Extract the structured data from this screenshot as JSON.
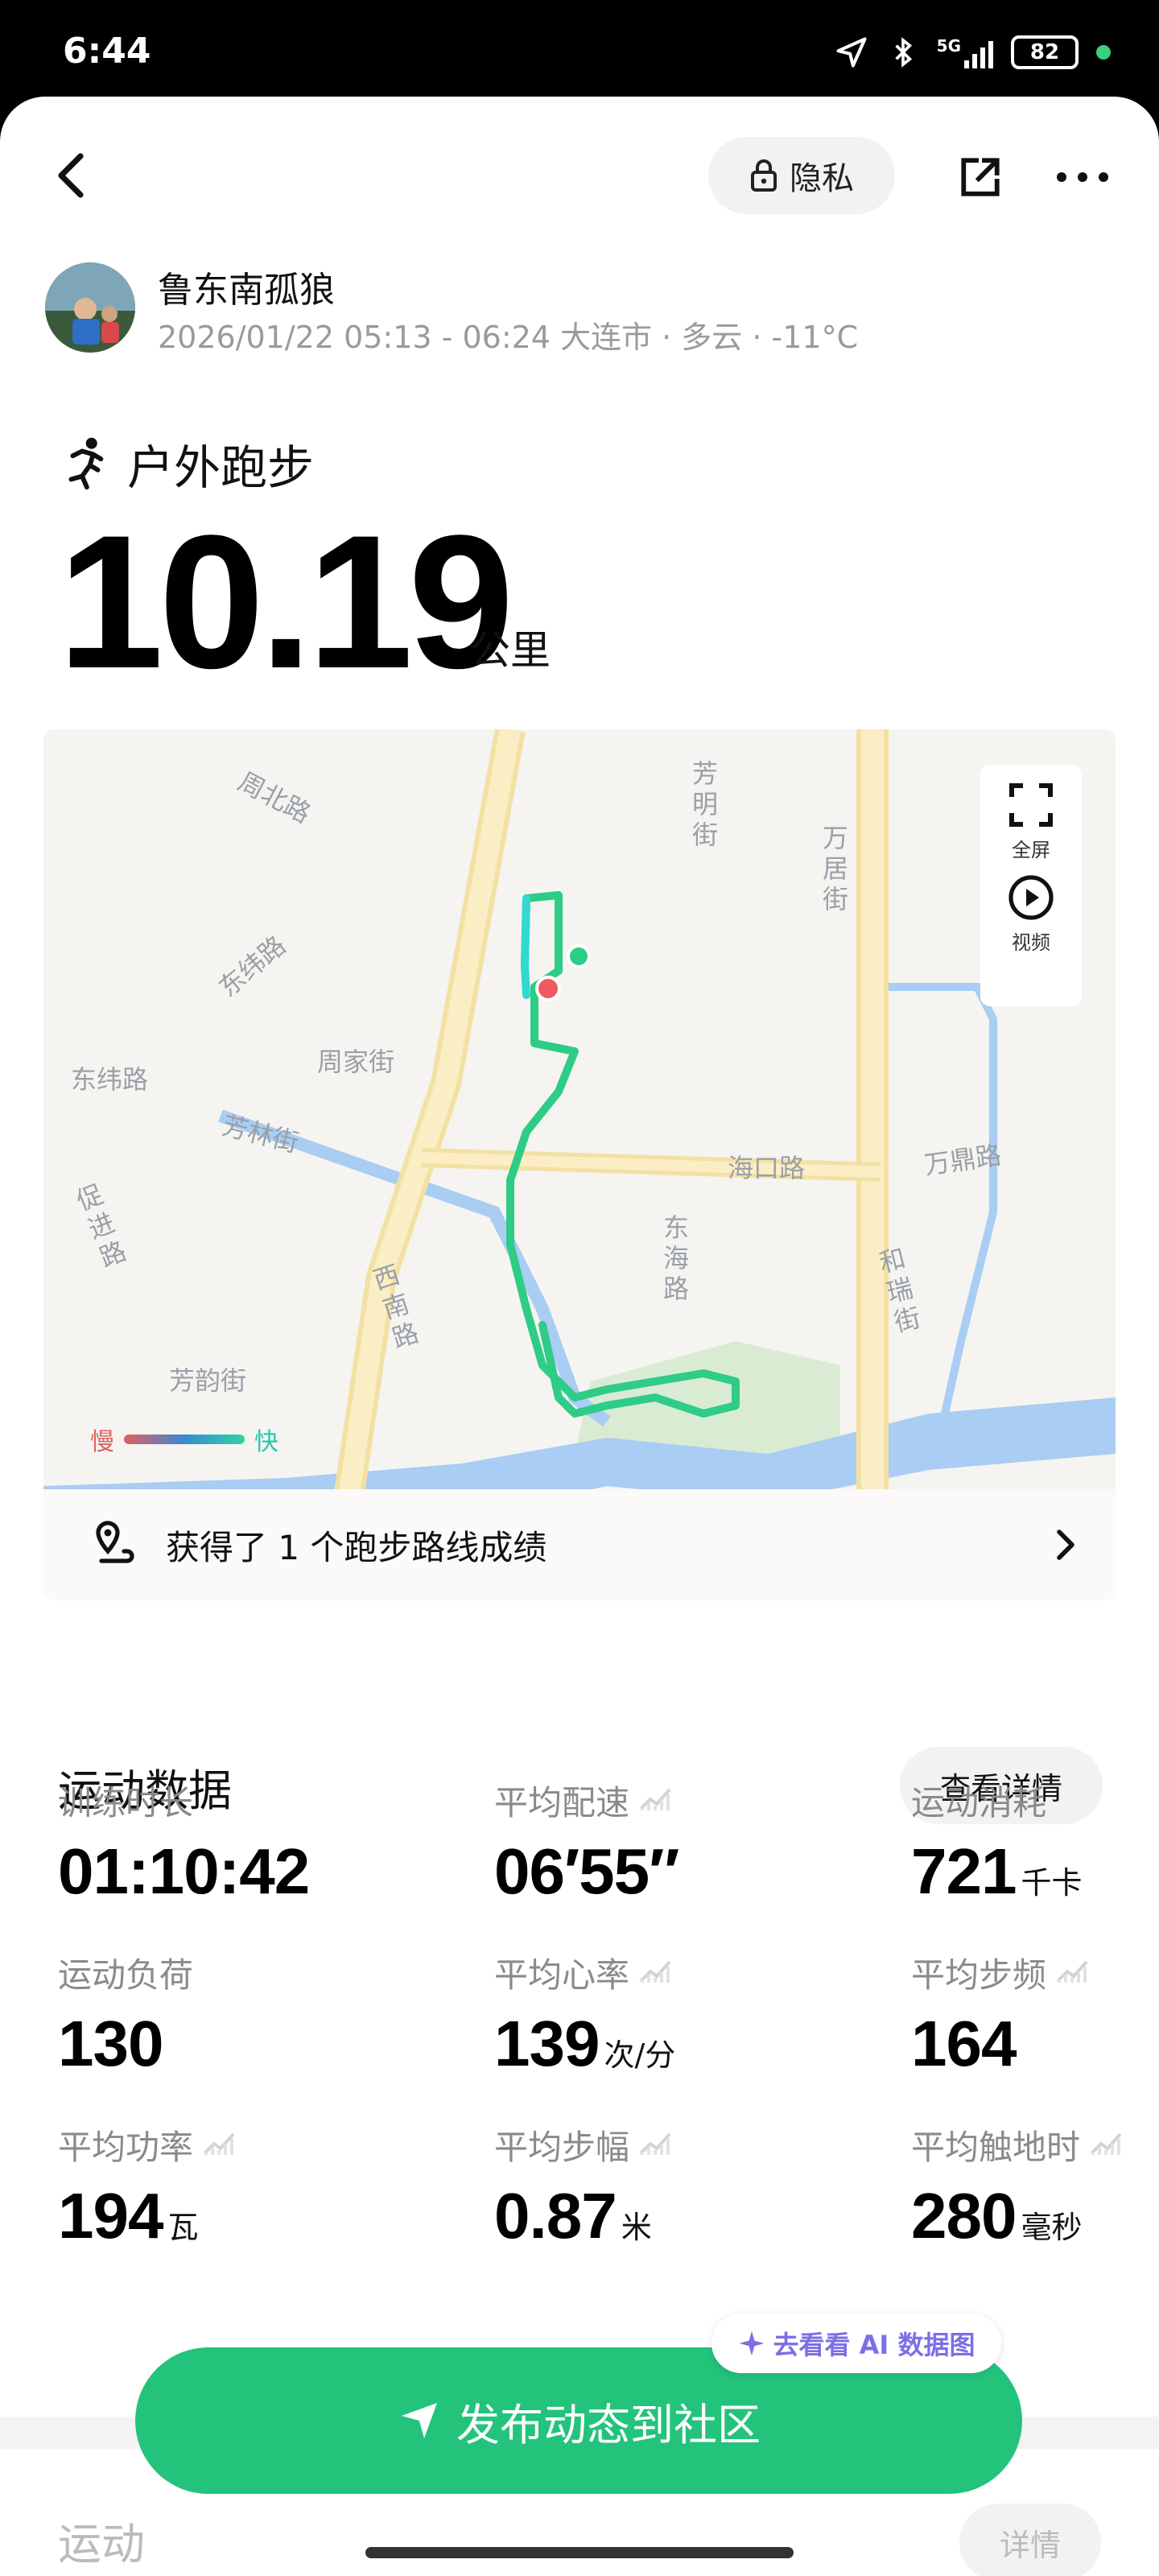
{
  "status_bar": {
    "time": "6:44",
    "network": "5G",
    "battery": "82"
  },
  "header": {
    "privacy_label": "隐私"
  },
  "user": {
    "name": "鲁东南孤狼",
    "meta": "2026/01/22 05:13 - 06:24 大连市 · 多云 · -11°C"
  },
  "workout": {
    "type": "户外跑步",
    "distance": "10.19",
    "unit": "公里"
  },
  "map": {
    "fullscreen_label": "全屏",
    "video_label": "视频",
    "legend_slow": "慢",
    "legend_fast": "快",
    "achievement": "获得了 1 个跑步路线成绩",
    "streets": {
      "zhoubei": "周北路",
      "dongwei_diag": "东纬路",
      "dongwei": "东纬路",
      "zhoujia": "周家街",
      "fanglin": "芳林街",
      "cujin": "促进路",
      "fangyun": "芳韵街",
      "xinan": "西南路",
      "fangming": "芳明街",
      "wanju": "万居街",
      "haikou": "海口路",
      "donghai": "东海路",
      "wanding": "万鼎路",
      "herui": "和瑞街"
    }
  },
  "stats": {
    "title": "运动数据",
    "detail_button": "查看详情",
    "items": [
      {
        "label": "训练时长",
        "value": "01:10:42",
        "unit": "",
        "chart": false
      },
      {
        "label": "平均配速",
        "value": "06′55″",
        "unit": "",
        "chart": true
      },
      {
        "label": "运动消耗",
        "value": "721",
        "unit": "千卡",
        "chart": false
      },
      {
        "label": "运动负荷",
        "value": "130",
        "unit": "",
        "chart": false
      },
      {
        "label": "平均心率",
        "value": "139",
        "unit": "次/分",
        "chart": true
      },
      {
        "label": "平均步频",
        "value": "164",
        "unit": "",
        "chart": true
      },
      {
        "label": "平均功率",
        "value": "194",
        "unit": "瓦",
        "chart": true
      },
      {
        "label": "平均步幅",
        "value": "0.87",
        "unit": "米",
        "chart": true
      },
      {
        "label": "平均触地时",
        "value": "280",
        "unit": "毫秒",
        "chart": true
      }
    ]
  },
  "section2": {
    "title": "运动",
    "button": "详情"
  },
  "ai_chip": {
    "label": "去看看 AI 数据图"
  },
  "publish": {
    "label": "发布动态到社区"
  },
  "colors": {
    "accent": "#23c37c",
    "route": "#2ecc86",
    "ai": "#7b6fe6"
  }
}
